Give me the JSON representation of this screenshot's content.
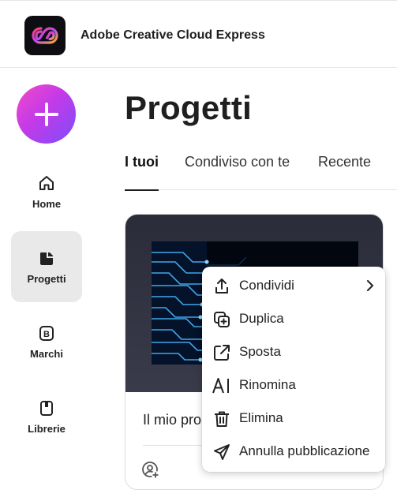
{
  "header": {
    "app_name": "Adobe Creative Cloud Express",
    "logo_icon": "creative-cloud-logo"
  },
  "sidebar": {
    "create_icon": "plus-icon",
    "items": [
      {
        "label": "Home",
        "icon": "home-icon",
        "active": false
      },
      {
        "label": "Progetti",
        "icon": "projects-icon",
        "active": true
      },
      {
        "label": "Marchi",
        "icon": "brand-icon",
        "active": false
      },
      {
        "label": "Librerie",
        "icon": "library-icon",
        "active": false
      }
    ]
  },
  "main": {
    "title": "Progetti",
    "tabs": [
      {
        "label": "I tuoi",
        "active": true
      },
      {
        "label": "Condiviso con te",
        "active": false
      },
      {
        "label": "Recente",
        "active": false
      }
    ],
    "card": {
      "title": "Il mio pro"
    }
  },
  "context_menu": {
    "items": [
      {
        "label": "Condividi",
        "icon": "share-icon",
        "submenu": true
      },
      {
        "label": "Duplica",
        "icon": "duplicate-icon"
      },
      {
        "label": "Sposta",
        "icon": "move-icon"
      },
      {
        "label": "Rinomina",
        "icon": "rename-icon"
      },
      {
        "label": "Elimina",
        "icon": "trash-icon"
      },
      {
        "label": "Annulla pubblicazione",
        "icon": "send-icon"
      }
    ]
  },
  "colors": {
    "accent_gradient_start": "#f24ac7",
    "accent_gradient_end": "#7b4dfb",
    "active_nav_bg": "#e9e9e9"
  }
}
